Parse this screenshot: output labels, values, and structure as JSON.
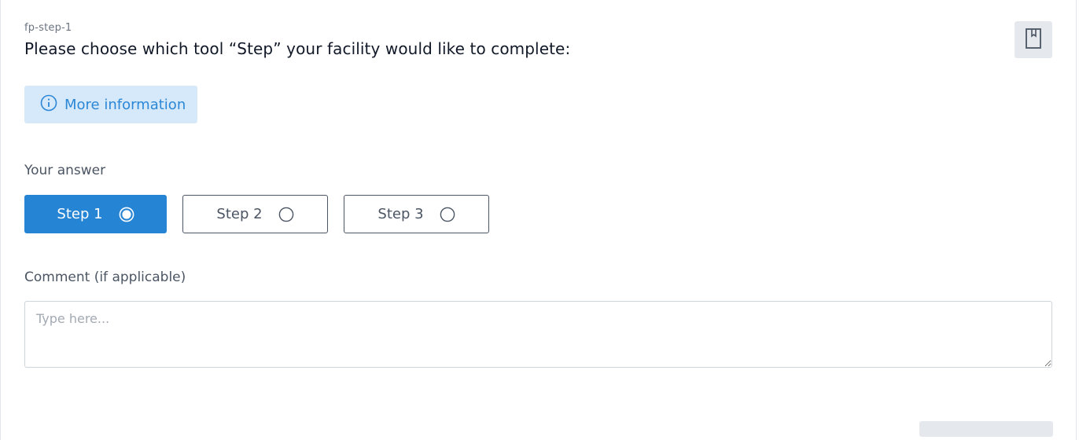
{
  "question": {
    "id": "fp-step-1",
    "text": "Please choose which tool “Step” your facility would like to complete:"
  },
  "info_button": {
    "label": "More information",
    "icon": "info-circle-icon"
  },
  "bookmark_button": {
    "icon": "bookmark-icon"
  },
  "answer": {
    "label": "Your answer",
    "options": [
      {
        "label": "Step 1",
        "selected": true
      },
      {
        "label": "Step 2",
        "selected": false
      },
      {
        "label": "Step 3",
        "selected": false
      }
    ]
  },
  "comment": {
    "label": "Comment (if applicable)",
    "placeholder": "Type here...",
    "value": ""
  },
  "colors": {
    "accent": "#2584d3",
    "info_bg": "#d6e9fb",
    "info_text": "#2b87d6",
    "bookmark_bg": "#e5e8ec"
  }
}
